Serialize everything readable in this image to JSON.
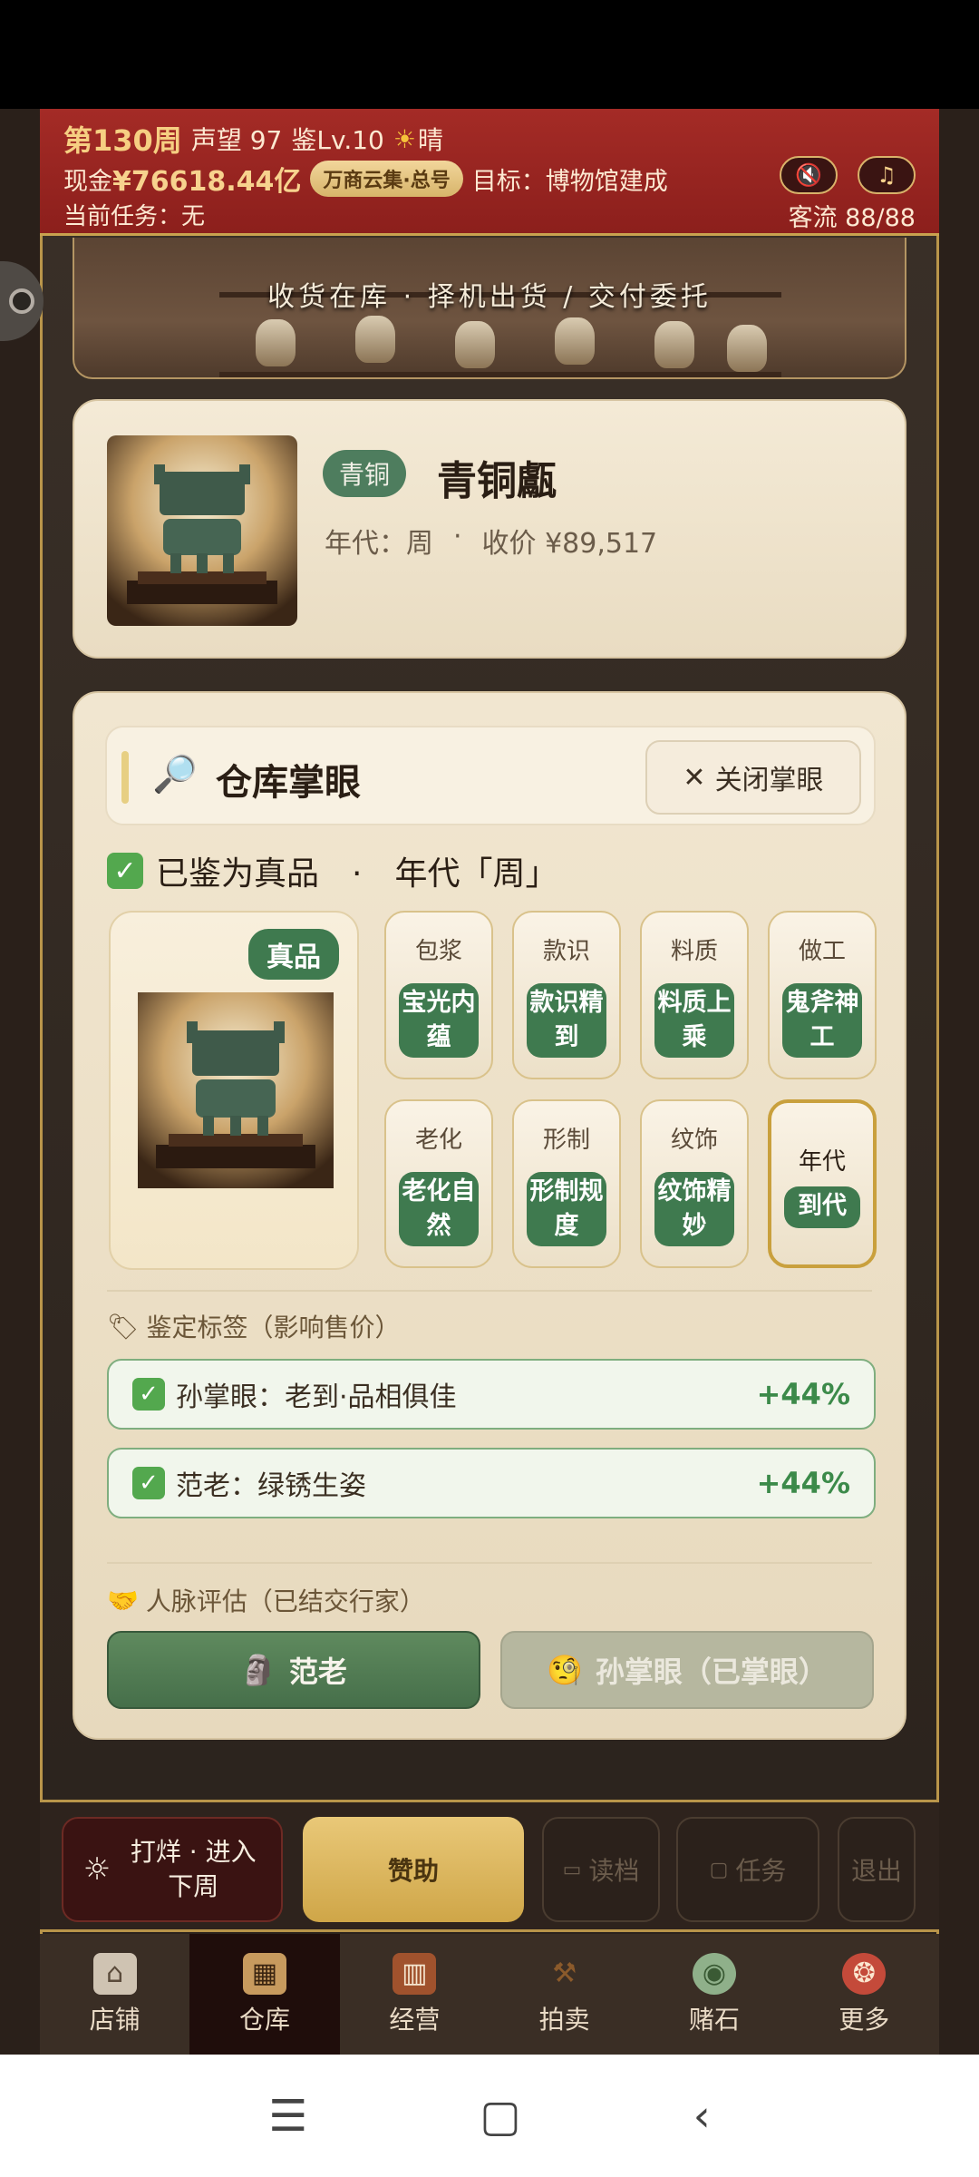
{
  "status": {
    "week": "第130周",
    "reputation": "声望 97",
    "level": "鉴Lv.10",
    "weather": "晴",
    "money_label": "现金",
    "money": "¥76618.44亿",
    "guild_badge": "万商云集·总号",
    "goal": "目标：博物馆建成",
    "task": "当前任务：无",
    "customers": "客流 88/88"
  },
  "banner": {
    "subtitle": "收货在库 · 择机出货 / 交付委托"
  },
  "item": {
    "category": "青铜",
    "name": "青铜甗",
    "era": "年代：周",
    "sep": "·",
    "price": "收价 ¥89,517"
  },
  "appraisal": {
    "title": "仓库掌眼",
    "close_label": "关闭掌眼",
    "verdict_text": "已鉴为真品　·　年代「周」",
    "genuine_badge": "真品",
    "traits": [
      {
        "title": "包浆",
        "value": "宝光内蕴"
      },
      {
        "title": "款识",
        "value": "款识精到"
      },
      {
        "title": "料质",
        "value": "料质上乘"
      },
      {
        "title": "做工",
        "value": "鬼斧神工"
      },
      {
        "title": "老化",
        "value": "老化自然"
      },
      {
        "title": "形制",
        "value": "形制规度"
      },
      {
        "title": "纹饰",
        "value": "纹饰精妙"
      },
      {
        "title": "年代",
        "value": "到代"
      }
    ],
    "tags_label": "鉴定标签（影响售价）",
    "bonuses": [
      {
        "text": "孙掌眼：老到·品相俱佳",
        "value": "+44%"
      },
      {
        "text": "范老：绿锈生姿",
        "value": "+44%"
      }
    ],
    "network_label": "人脉评估（已结交行家）",
    "contacts": [
      {
        "label": "范老"
      },
      {
        "label": "孙掌眼（已掌眼）"
      }
    ]
  },
  "actions": {
    "next_week": "打烊 · 进入下周",
    "sponsor": "赞助",
    "load": "读档",
    "task": "任务",
    "exit": "退出"
  },
  "nav": [
    {
      "label": "店铺",
      "icon": "shop-icon"
    },
    {
      "label": "仓库",
      "icon": "warehouse-icon"
    },
    {
      "label": "经营",
      "icon": "ledger-icon"
    },
    {
      "label": "拍卖",
      "icon": "gavel-icon"
    },
    {
      "label": "赌石",
      "icon": "jade-stone-icon"
    },
    {
      "label": "更多",
      "icon": "more-icon"
    }
  ],
  "colors": {
    "header_red": "#9a2420",
    "accent_green": "#3f7a4f",
    "gold": "#c9a03d"
  }
}
